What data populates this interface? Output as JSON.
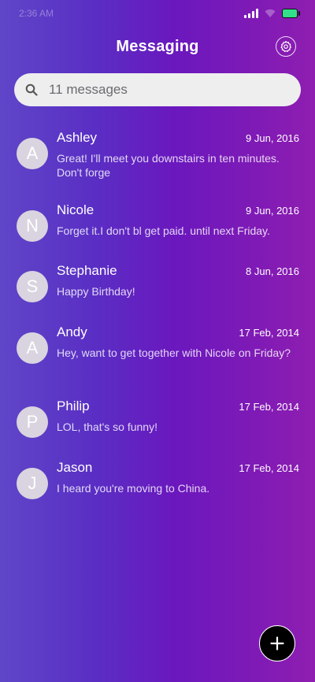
{
  "status_bar": {
    "time": "2:36 AM"
  },
  "header": {
    "title": "Messaging"
  },
  "search": {
    "placeholder": "11 messages"
  },
  "messages": [
    {
      "initial": "A",
      "name": "Ashley",
      "date": "9 Jun, 2016",
      "preview": "Great! I'll meet you downstairs in ten minutes. Don't forge"
    },
    {
      "initial": "N",
      "name": "Nicole",
      "date": "9 Jun, 2016",
      "preview": "Forget it.I don't bl get paid. until next Friday."
    },
    {
      "initial": "S",
      "name": "Stephanie",
      "date": "8 Jun, 2016",
      "preview": "Happy Birthday!"
    },
    {
      "initial": "A",
      "name": "Andy",
      "date": "17 Feb, 2014",
      "preview": "Hey, want to get together with Nicole on Friday?"
    },
    {
      "initial": "P",
      "name": "Philip",
      "date": "17 Feb, 2014",
      "preview": "LOL, that's so funny!"
    },
    {
      "initial": "J",
      "name": "Jason",
      "date": "17 Feb, 2014",
      "preview": "I heard you're moving to China."
    }
  ],
  "icons": {
    "settings": "gear-icon",
    "search": "search-icon",
    "compose": "plus-icon"
  }
}
